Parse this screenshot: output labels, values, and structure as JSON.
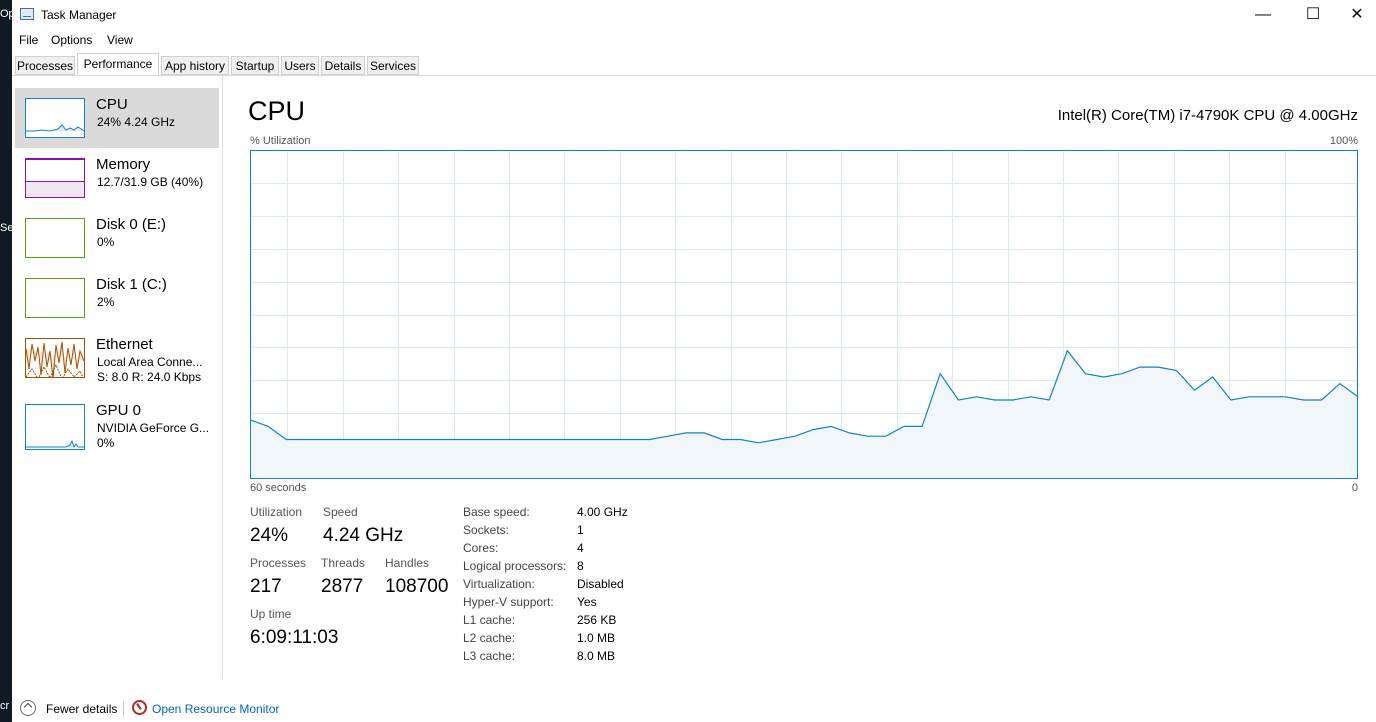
{
  "window": {
    "title": "Task Manager",
    "minimize": "—",
    "maximize": "☐",
    "close": "✕"
  },
  "menu": [
    "File",
    "Options",
    "View"
  ],
  "tabs": [
    {
      "label": "Processes"
    },
    {
      "label": "Performance",
      "active": true
    },
    {
      "label": "App history"
    },
    {
      "label": "Startup"
    },
    {
      "label": "Users"
    },
    {
      "label": "Details"
    },
    {
      "label": "Services"
    }
  ],
  "sidebar": {
    "items": [
      {
        "name": "CPU",
        "sub": "24%  4.24 GHz",
        "color": "#1183c7",
        "selected": true
      },
      {
        "name": "Memory",
        "sub": "12.7/31.9 GB (40%)",
        "color": "#8b12ae",
        "level": 0.4
      },
      {
        "name": "Disk 0 (E:)",
        "sub": "0%",
        "color": "#4da60c"
      },
      {
        "name": "Disk 1 (C:)",
        "sub": "2%",
        "color": "#4da60c"
      },
      {
        "name": "Ethernet",
        "sub": "Local Area Conne...",
        "sub2": "S: 8.0  R: 24.0 Kbps",
        "color": "#a74f01"
      },
      {
        "name": "GPU 0",
        "sub": "NVIDIA GeForce G...",
        "sub2": "0%",
        "color": "#1183c7"
      }
    ]
  },
  "main": {
    "title": "CPU",
    "model": "Intel(R) Core(TM) i7-4790K CPU @ 4.00GHz",
    "util_label": "% Utilization",
    "max_label": "100%",
    "time_label": "60 seconds",
    "min_label": "0"
  },
  "chart_data": {
    "type": "area",
    "ylim": [
      0,
      100
    ],
    "xlim": [
      60,
      0
    ],
    "grid": true,
    "color": "#1183c7",
    "values": [
      18,
      16,
      12,
      12,
      12,
      12,
      12,
      12,
      12,
      12,
      12,
      12,
      12,
      12,
      12,
      12,
      12,
      12,
      12,
      12,
      12,
      12,
      12,
      13,
      14,
      14,
      12,
      12,
      11,
      12,
      13,
      15,
      16,
      14,
      13,
      13,
      16,
      16,
      32,
      24,
      25,
      24,
      24,
      25,
      24,
      39,
      32,
      31,
      32,
      34,
      34,
      33,
      27,
      31,
      24,
      25,
      25,
      25,
      24,
      24,
      29,
      25
    ],
    "values_note": ""
  },
  "stats": {
    "utilization": {
      "label": "Utilization",
      "value": "24%"
    },
    "speed": {
      "label": "Speed",
      "value": "4.24 GHz"
    },
    "processes": {
      "label": "Processes",
      "value": "217"
    },
    "threads": {
      "label": "Threads",
      "value": "2877"
    },
    "handles": {
      "label": "Handles",
      "value": "108700"
    },
    "uptime": {
      "label": "Up time",
      "value": "6:09:11:03"
    }
  },
  "specs": [
    {
      "k": "Base speed:",
      "v": "4.00 GHz"
    },
    {
      "k": "Sockets:",
      "v": "1"
    },
    {
      "k": "Cores:",
      "v": "4"
    },
    {
      "k": "Logical processors:",
      "v": "8"
    },
    {
      "k": "Virtualization:",
      "v": "Disabled"
    },
    {
      "k": "Hyper-V support:",
      "v": "Yes"
    },
    {
      "k": "L1 cache:",
      "v": "256 KB"
    },
    {
      "k": "L2 cache:",
      "v": "1.0 MB"
    },
    {
      "k": "L3 cache:",
      "v": "8.0 MB"
    }
  ],
  "footer": {
    "fewer": "Fewer details",
    "monitor": "Open Resource Monitor"
  }
}
